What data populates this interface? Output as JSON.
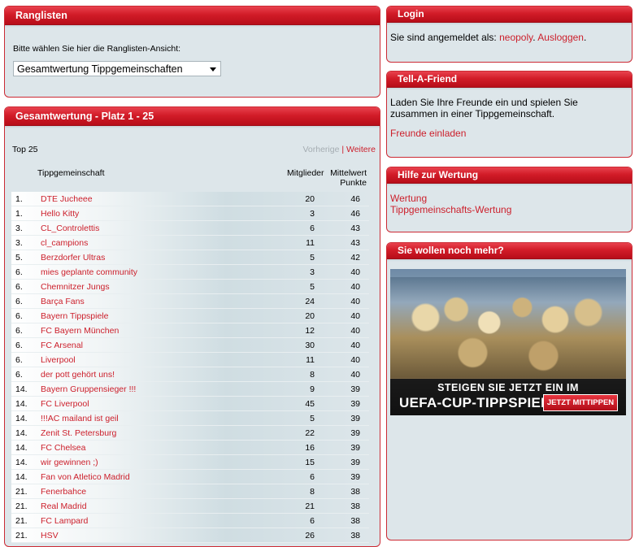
{
  "ranglisten": {
    "title": "Ranglisten",
    "prompt": "Bitte wählen Sie hier die Ranglisten-Ansicht:",
    "selected": "Gesamtwertung Tippgemeinschaften"
  },
  "standings": {
    "title": "Gesamtwertung - Platz 1 - 25",
    "top_label": "Top 25",
    "prev": "Vorherige",
    "separator": "|",
    "next": "Weitere",
    "col_name": "Tippgemeinschaft",
    "col_members": "Mitglieder",
    "col_avg_1": "Mittelwert",
    "col_avg_2": "Punkte",
    "rows": [
      {
        "pos": "1.",
        "name": "DTE Jucheee",
        "members": "20",
        "points": "46"
      },
      {
        "pos": "1.",
        "name": "Hello Kitty",
        "members": "3",
        "points": "46"
      },
      {
        "pos": "3.",
        "name": "CL_Controlettis",
        "members": "6",
        "points": "43"
      },
      {
        "pos": "3.",
        "name": "cl_campions",
        "members": "11",
        "points": "43"
      },
      {
        "pos": "5.",
        "name": "Berzdorfer Ultras",
        "members": "5",
        "points": "42"
      },
      {
        "pos": "6.",
        "name": "mies geplante community",
        "members": "3",
        "points": "40"
      },
      {
        "pos": "6.",
        "name": "Chemnitzer Jungs",
        "members": "5",
        "points": "40"
      },
      {
        "pos": "6.",
        "name": "Barça Fans",
        "members": "24",
        "points": "40"
      },
      {
        "pos": "6.",
        "name": "Bayern Tippspiele",
        "members": "20",
        "points": "40"
      },
      {
        "pos": "6.",
        "name": "FC Bayern München",
        "members": "12",
        "points": "40"
      },
      {
        "pos": "6.",
        "name": "FC Arsenal",
        "members": "30",
        "points": "40"
      },
      {
        "pos": "6.",
        "name": "Liverpool",
        "members": "11",
        "points": "40"
      },
      {
        "pos": "6.",
        "name": "der pott gehört uns!",
        "members": "8",
        "points": "40"
      },
      {
        "pos": "14.",
        "name": "Bayern Gruppensieger !!!",
        "members": "9",
        "points": "39"
      },
      {
        "pos": "14.",
        "name": "FC Liverpool",
        "members": "45",
        "points": "39"
      },
      {
        "pos": "14.",
        "name": "!!!AC mailand ist geil",
        "members": "5",
        "points": "39"
      },
      {
        "pos": "14.",
        "name": "Zenit St. Petersburg",
        "members": "22",
        "points": "39"
      },
      {
        "pos": "14.",
        "name": "FC Chelsea",
        "members": "16",
        "points": "39"
      },
      {
        "pos": "14.",
        "name": "wir gewinnen ;)",
        "members": "15",
        "points": "39"
      },
      {
        "pos": "14.",
        "name": "Fan von Atletico Madrid",
        "members": "6",
        "points": "39"
      },
      {
        "pos": "21.",
        "name": "Fenerbahce",
        "members": "8",
        "points": "38"
      },
      {
        "pos": "21.",
        "name": "Real Madrid",
        "members": "21",
        "points": "38"
      },
      {
        "pos": "21.",
        "name": "FC Lampard",
        "members": "6",
        "points": "38"
      },
      {
        "pos": "21.",
        "name": "HSV",
        "members": "26",
        "points": "38"
      }
    ]
  },
  "login": {
    "title": "Login",
    "text": "Sie sind angemeldet als:",
    "user": "neopoly",
    "dot1": ".",
    "logout": "Ausloggen",
    "dot2": "."
  },
  "tell": {
    "title": "Tell-A-Friend",
    "text": "Laden Sie Ihre Freunde ein und spielen Sie zusammen in einer Tippgemeinschaft.",
    "link": "Freunde einladen"
  },
  "hilfe": {
    "title": "Hilfe zur Wertung",
    "link1": "Wertung",
    "link2": "Tippgemeinschafts-Wertung"
  },
  "promo": {
    "title": "Sie wollen noch mehr?",
    "line1": "STEIGEN SIE JETZT EIN IM",
    "line2": "UEFA-CUP-TIPPSPIEL",
    "button": "JETZT MITTIPPEN"
  }
}
